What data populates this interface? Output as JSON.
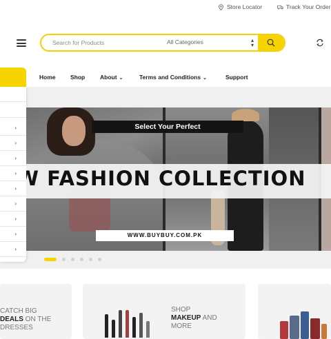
{
  "topbar": {
    "store_locator": "Store Locator",
    "track_order": "Track Your Order"
  },
  "header": {
    "search_placeholder": "Search for Products",
    "category_selected": "All Categories"
  },
  "nav": {
    "items": [
      {
        "label": "Home",
        "dropdown": false
      },
      {
        "label": "Shop",
        "dropdown": false
      },
      {
        "label": "About",
        "dropdown": true
      },
      {
        "label": "Terms and Conditions",
        "dropdown": true
      },
      {
        "label": "Support",
        "dropdown": false
      }
    ]
  },
  "banner": {
    "tagline": "Select Your Perfect",
    "headline": "W FASHION COLLECTION",
    "url": "WWW.BUYBUY.COM.PK",
    "slides": 6,
    "active_slide": 1
  },
  "promos": [
    {
      "line1": "CATCH BIG",
      "bold": "DEALS",
      "rest": " ON THE",
      "line3": "DRESSES"
    },
    {
      "line1": "SHOP",
      "bold": "MAKEUP",
      "rest": " AND",
      "line3": "MORE"
    }
  ],
  "colors": {
    "accent": "#f7d300",
    "background": "#f0f0f0"
  }
}
